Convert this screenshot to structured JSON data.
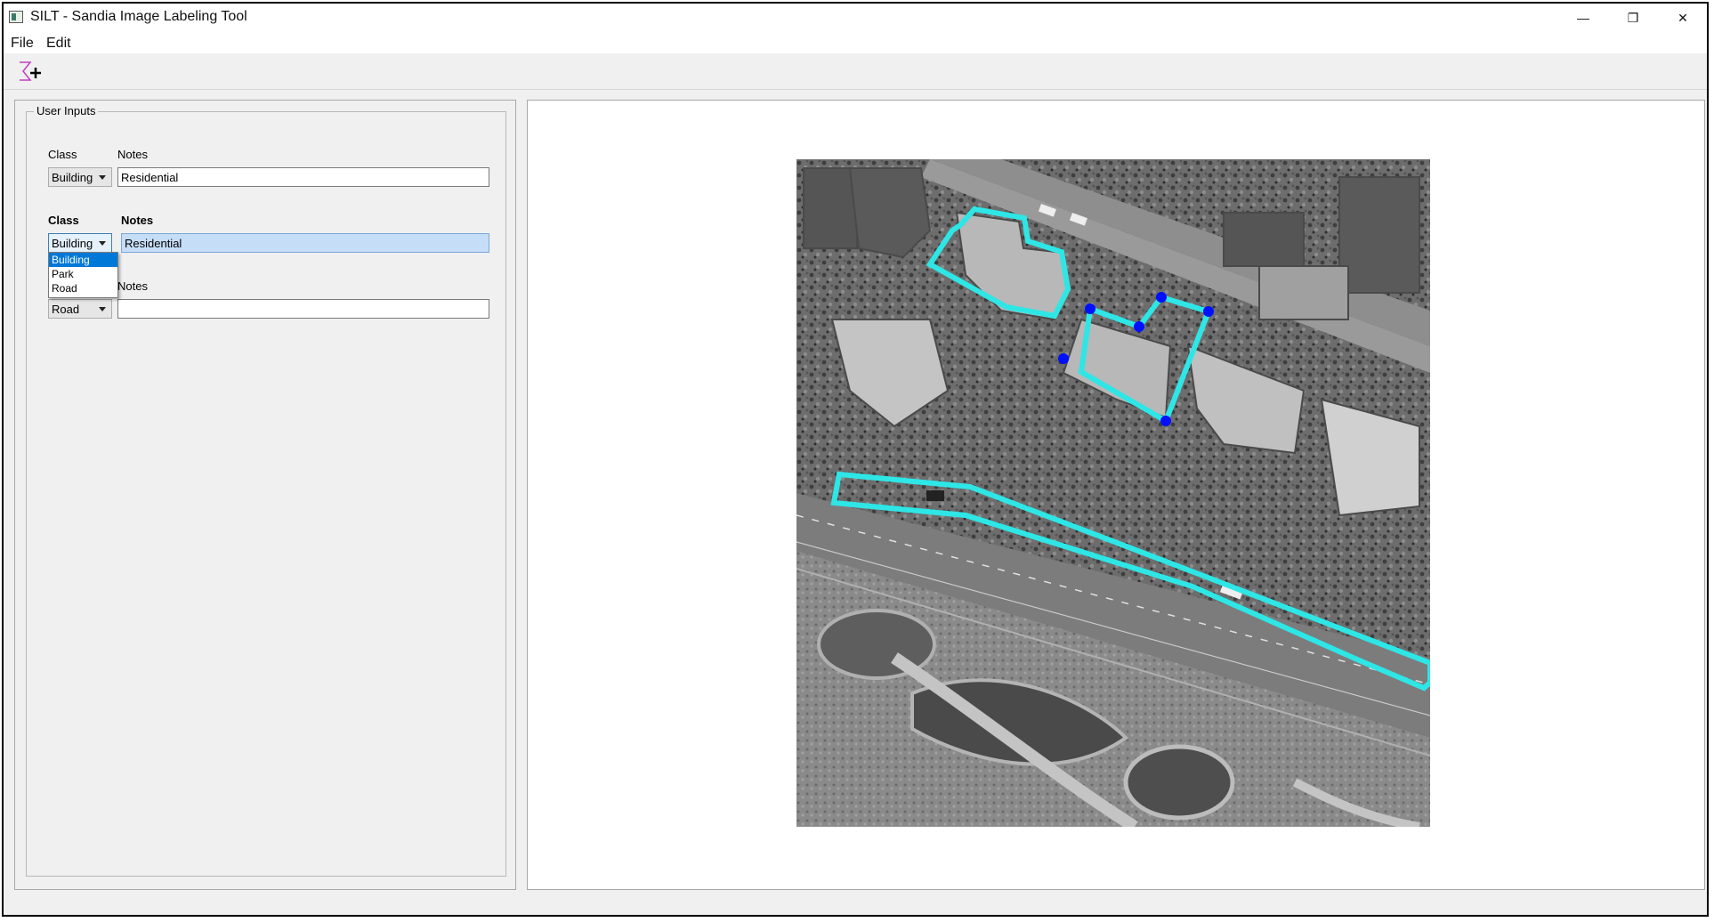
{
  "window": {
    "title": "SILT - Sandia Image Labeling Tool",
    "controls": {
      "minimize": "—",
      "restore": "❐",
      "close": "✕"
    }
  },
  "menu": [
    "File",
    "Edit"
  ],
  "toolbar": {
    "icon": "add-polygon-icon"
  },
  "user_inputs": {
    "title": "User Inputs",
    "rows": [
      {
        "class_label": "Class",
        "notes_label": "Notes",
        "class_value": "Building",
        "notes_value": "Residential"
      },
      {
        "class_label": "Class",
        "notes_label": "Notes",
        "class_value": "Building",
        "notes_value": "Residential"
      },
      {
        "notes_label": "Notes",
        "class_value": "Road",
        "notes_value": ""
      }
    ],
    "dropdown_options": [
      "Building",
      "Park",
      "Road"
    ],
    "dropdown_selected": "Building"
  },
  "colors": {
    "polygon": "#2ee6e6",
    "vertex": "#0010ff",
    "dropdown_highlight": "#0078d7",
    "selected_field": "#c6ddf7"
  }
}
